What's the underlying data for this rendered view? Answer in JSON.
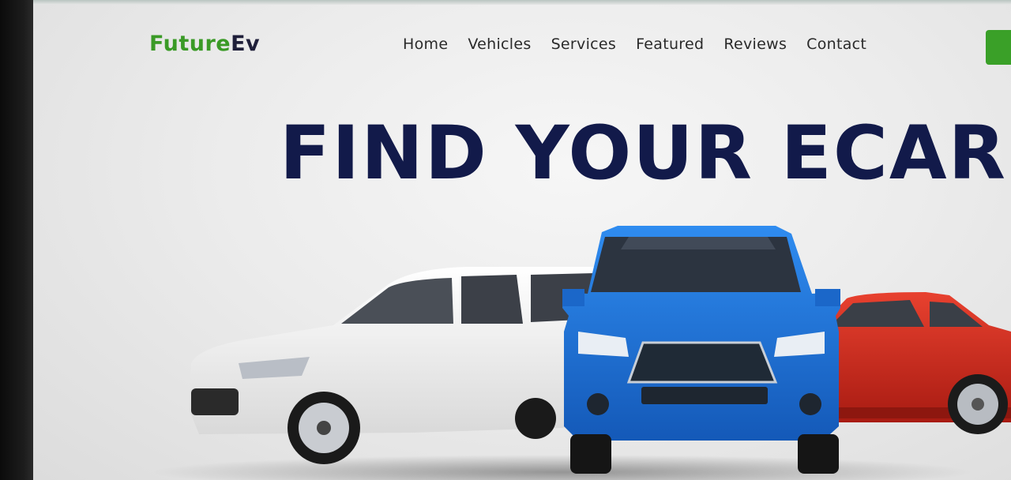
{
  "header": {
    "logo_part1": "Future",
    "logo_part2": "Ev",
    "nav": [
      "Home",
      "Vehicles",
      "Services",
      "Featured",
      "Reviews",
      "Contact"
    ]
  },
  "hero": {
    "title": "FIND YOUR ECAR"
  },
  "colors": {
    "brand_green": "#3a9a26",
    "heading_navy": "#121a4a",
    "car_white": "#f2f2f2",
    "car_blue": "#1e73d6",
    "car_red": "#d42a1e"
  }
}
